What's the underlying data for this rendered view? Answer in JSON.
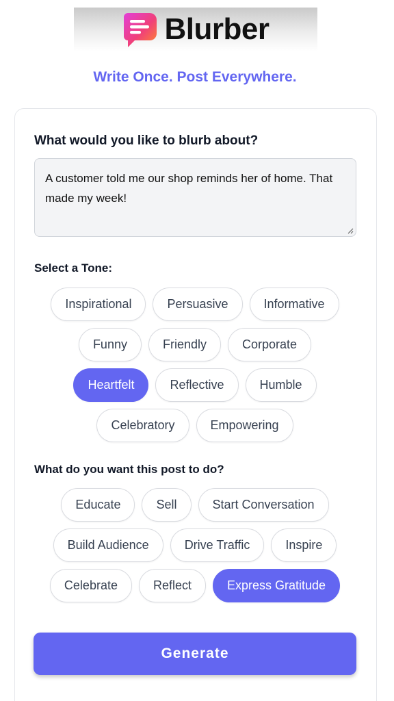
{
  "app": {
    "name": "Blurber",
    "tagline": "Write Once. Post Everywhere.",
    "accent_color": "#6366f1",
    "logo_icon": "speech-bubble-logo-icon"
  },
  "topic": {
    "label": "What would you like to blurb about?",
    "value": "A customer told me our shop reminds her of home. That made my week!"
  },
  "tone": {
    "label": "Select a Tone:",
    "rows": [
      [
        {
          "label": "Inspirational"
        },
        {
          "label": "Persuasive"
        },
        {
          "label": "Informative"
        }
      ],
      [
        {
          "label": "Funny"
        },
        {
          "label": "Friendly"
        },
        {
          "label": "Corporate"
        }
      ],
      [
        {
          "label": "Heartfelt",
          "selected": true
        },
        {
          "label": "Reflective"
        },
        {
          "label": "Humble"
        }
      ],
      [
        {
          "label": "Celebratory"
        },
        {
          "label": "Empowering"
        }
      ]
    ]
  },
  "goal": {
    "label": "What do you want this post to do?",
    "rows": [
      [
        {
          "label": "Educate"
        },
        {
          "label": "Sell"
        },
        {
          "label": "Start Conversation"
        }
      ],
      [
        {
          "label": "Build Audience"
        },
        {
          "label": "Drive Traffic"
        },
        {
          "label": "Inspire"
        }
      ],
      [
        {
          "label": "Celebrate"
        },
        {
          "label": "Reflect"
        },
        {
          "label": "Express Gratitude",
          "selected": true
        }
      ]
    ]
  },
  "generate": {
    "label": "Generate"
  }
}
